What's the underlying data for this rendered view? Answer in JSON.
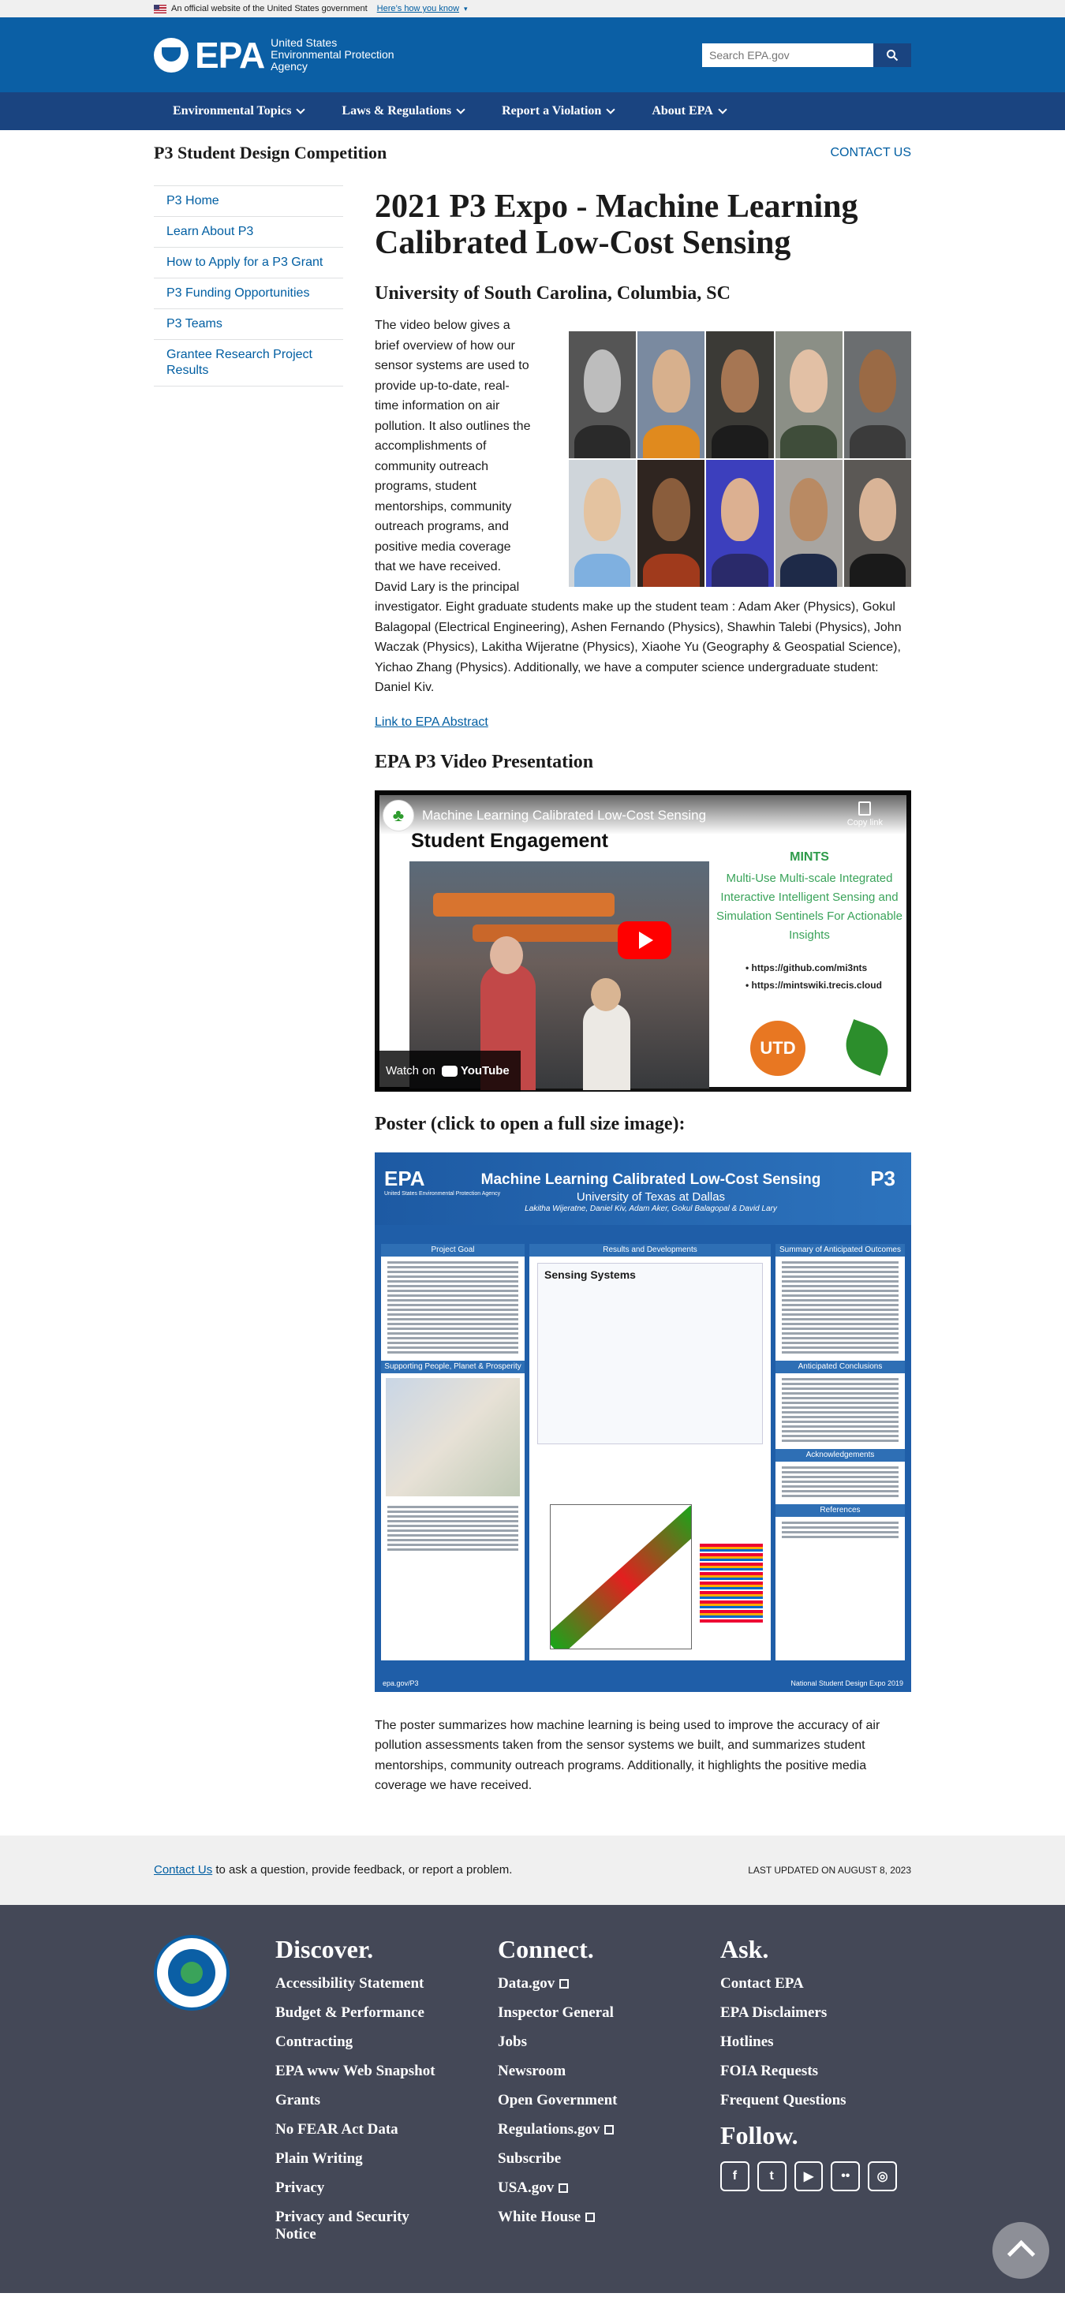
{
  "banner": {
    "text": "An official website of the United States government",
    "link": "Here’s how you know"
  },
  "header": {
    "logo": "EPA",
    "agency": "United States Environmental Protection Agency",
    "search_placeholder": "Search EPA.gov"
  },
  "nav": [
    "Environmental Topics",
    "Laws & Regulations",
    "Report a Violation",
    "About EPA"
  ],
  "section": {
    "title": "P3 Student Design Competition",
    "contact": "CONTACT US"
  },
  "sidenav": [
    "P3 Home",
    "Learn About P3",
    "How to Apply for a P3 Grant",
    "P3 Funding Opportunities",
    "P3 Teams",
    "Grantee Research Project Results"
  ],
  "page": {
    "title": "2021 P3 Expo - Machine Learning Calibrated Low-Cost Sensing",
    "subtitle": "University of South Carolina, Columbia, SC",
    "intro": "The video below gives a brief overview of how our sensor systems are used to provide up-to-date, real-time information on air pollution. It also outlines the accomplishments of community outreach programs, student mentorships, community outreach programs, and positive media coverage that we have received. David Lary is the principal investigator. Eight graduate students make up the student team : Adam Aker (Physics), Gokul Balagopal (Electrical Engineering), Ashen Fernando (Physics), Shawhin Talebi (Physics), John Waczak (Physics), Lakitha Wijeratne (Physics), Xiaohe Yu (Geography & Geospatial Science), Yichao Zhang (Physics). Additionally, we have a computer science undergraduate student: Daniel Kiv.",
    "abstract_link": "Link to EPA Abstract",
    "video_heading": "EPA P3 Video Presentation",
    "poster_heading": "Poster (click to open a full size image):",
    "poster_summary": "The poster summarizes how machine learning is being used to improve the accuracy of air pollution assessments taken from the sensor systems we built, and summarizes student mentorships, community outreach programs. Additionally, it highlights the positive media coverage we have received."
  },
  "video": {
    "title": "Machine Learning Calibrated Low-Cost Sensing",
    "copy": "Copy link",
    "slide_heading": "Student Engagement",
    "mints_title": "MINTS",
    "mints_desc": "Multi-Use Multi-scale Integrated Interactive Intelligent Sensing and Simulation Sentinels For Actionable Insights",
    "url1": "• https://github.com/mi3nts",
    "url2": "• https://mintswiki.trecis.cloud",
    "utd": "UTD",
    "watch": "Watch on",
    "youtube": "YouTube"
  },
  "poster": {
    "logo": "EPA",
    "agency": "United States Environmental Protection Agency",
    "title": "Machine Learning Calibrated Low-Cost Sensing",
    "university": "University of Texas at Dallas",
    "authors": "Lakitha Wijeratne, Daniel Kiv, Adam Aker, Gokul Balagopal & David Lary",
    "p3": "P3",
    "col1": "Project Goal",
    "col1b": "Supporting People, Planet & Prosperity",
    "col2": "Results and Developments",
    "col2_sub": "Sensing Systems",
    "col3": "Summary of Anticipated Outcomes",
    "col3b": "Anticipated Conclusions",
    "col3c": "Acknowledgements",
    "col3d": "References",
    "footer_left": "epa.gov/P3",
    "footer_right": "National Student Design Expo 2019"
  },
  "feedback": {
    "link": "Contact Us",
    "text": " to ask a question, provide feedback, or report a problem.",
    "updated": "LAST UPDATED ON AUGUST 8, 2023"
  },
  "footer": {
    "discover": {
      "title": "Discover.",
      "items": [
        "Accessibility Statement",
        "Budget & Performance",
        "Contracting",
        "EPA www Web Snapshot",
        "Grants",
        "No FEAR Act Data",
        "Plain Writing",
        "Privacy",
        "Privacy and Security Notice"
      ]
    },
    "connect": {
      "title": "Connect.",
      "items": [
        "Data.gov",
        "Inspector General",
        "Jobs",
        "Newsroom",
        "Open Government",
        "Regulations.gov",
        "Subscribe",
        "USA.gov",
        "White House"
      ]
    },
    "ask": {
      "title": "Ask.",
      "items": [
        "Contact EPA",
        "EPA Disclaimers",
        "Hotlines",
        "FOIA Requests",
        "Frequent Questions"
      ]
    },
    "follow": "Follow."
  },
  "colors": {
    "header": "#0b5fa5",
    "nav": "#1a4480",
    "link": "#005ea2",
    "footer": "#444857"
  }
}
